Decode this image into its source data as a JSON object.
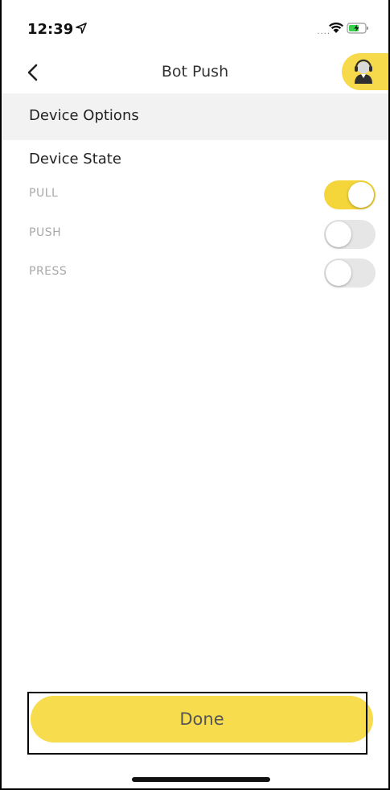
{
  "status_bar": {
    "time": "12:39",
    "signal_dots": "....",
    "icons": [
      "location-arrow-icon",
      "wifi-icon",
      "battery-charging-icon"
    ]
  },
  "nav": {
    "title": "Bot Push",
    "back_icon": "chevron-left-icon",
    "support_icon": "customer-support-icon"
  },
  "section": {
    "title": "Device Options"
  },
  "device_state": {
    "heading": "Device State",
    "options": [
      {
        "label": "PULL",
        "enabled": true
      },
      {
        "label": "PUSH",
        "enabled": false
      },
      {
        "label": "PRESS",
        "enabled": false
      }
    ]
  },
  "footer": {
    "done_label": "Done"
  },
  "colors": {
    "accent": "#f4d53a",
    "section_bg": "#f2f2f2",
    "option_label": "#a8a8a8"
  }
}
